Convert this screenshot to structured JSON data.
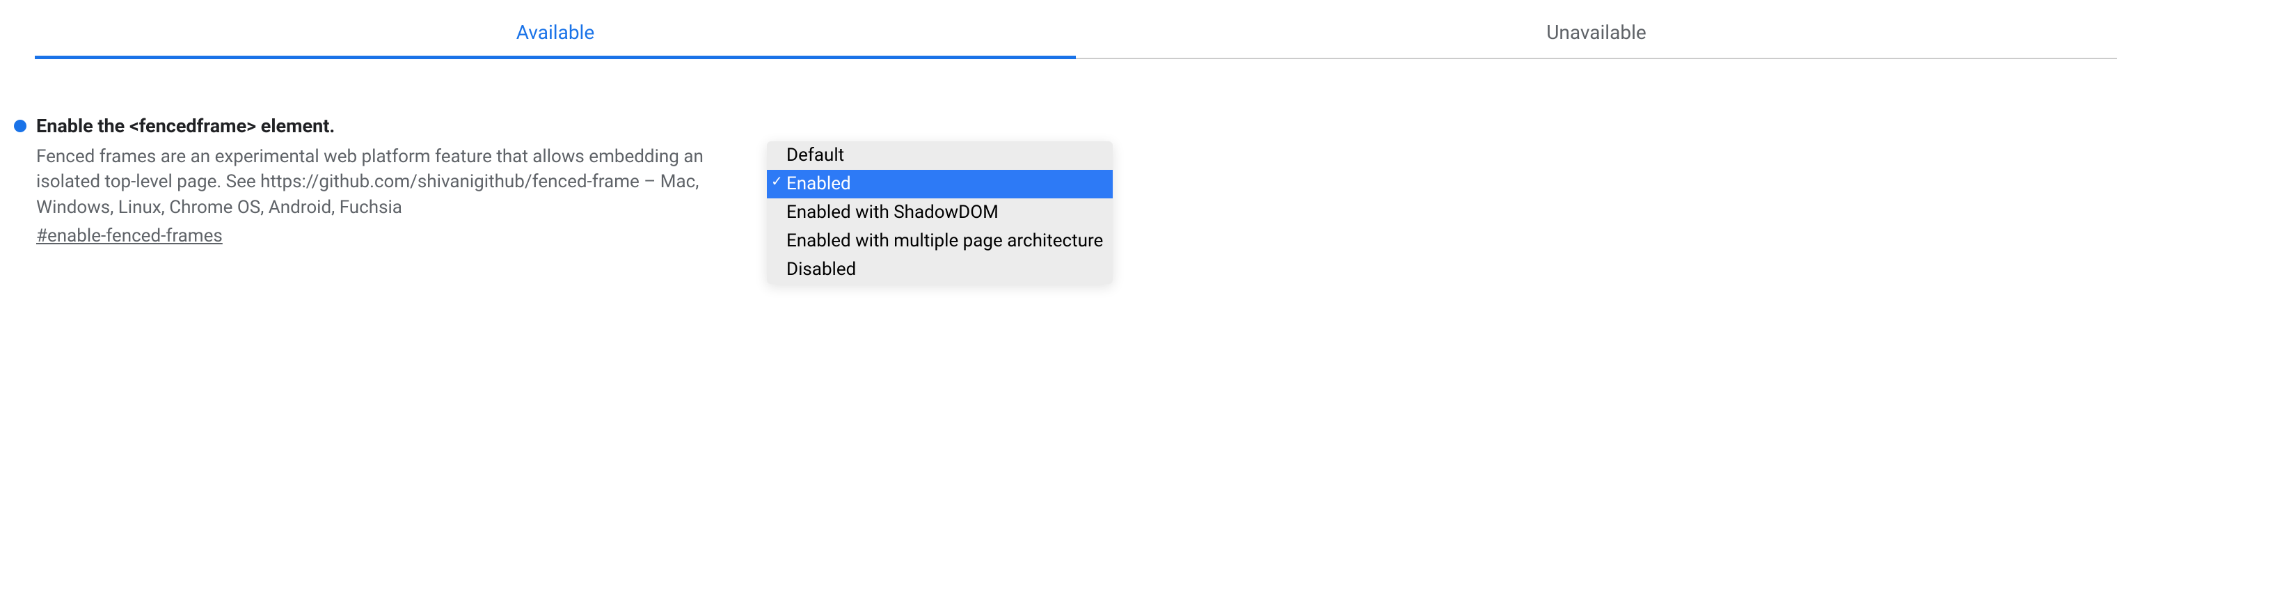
{
  "tabs": {
    "available": "Available",
    "unavailable": "Unavailable"
  },
  "flag": {
    "title": "Enable the <fencedframe> element.",
    "description": "Fenced frames are an experimental web platform feature that allows embedding an isolated top-level page. See https://github.com/shivanigithub/fenced-frame – Mac, Windows, Linux, Chrome OS, Android, Fuchsia",
    "hash": "#enable-fenced-frames"
  },
  "dropdown": {
    "options": [
      "Default",
      "Enabled",
      "Enabled with ShadowDOM",
      "Enabled with multiple page architecture",
      "Disabled"
    ],
    "selected": "Enabled"
  }
}
